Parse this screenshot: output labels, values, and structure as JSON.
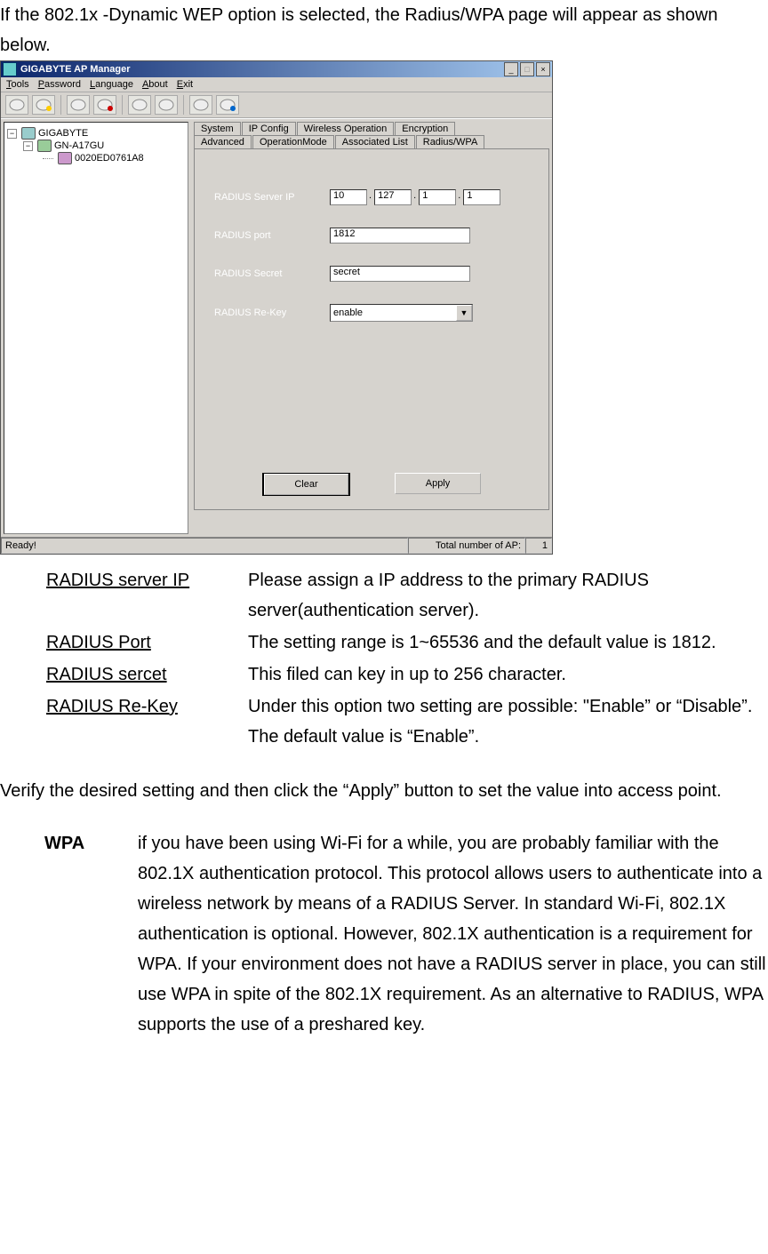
{
  "intro1": "If the 802.1x -Dynamic WEP option is selected, the Radius/WPA page will appear as shown below.",
  "window": {
    "title": "GIGABYTE AP Manager",
    "menutext": {
      "tools": "Tools",
      "password": "Password",
      "language": "Language",
      "about": "About",
      "exit": "Exit"
    },
    "tree": {
      "root": "GIGABYTE",
      "lvl1": "GN-A17GU",
      "lvl2": "0020ED0761A8"
    },
    "tabs": {
      "system": "System",
      "ipconfig": "IP Config",
      "wireless": "Wireless Operation",
      "encryption": "Encryption",
      "advanced": "Advanced",
      "opmode": "OperationMode",
      "assoc": "Associated List",
      "radius": "Radius/WPA"
    },
    "form": {
      "ip_label": "RADIUS Server IP",
      "ip1": "10",
      "ip2": "127",
      "ip3": "1",
      "ip4": "1",
      "port_label": "RADIUS port",
      "port": "1812",
      "secret_label": "RADIUS Secret",
      "secret": "secret",
      "rekey_label": "RADIUS Re-Key",
      "rekey": "enable"
    },
    "buttons": {
      "clear": "Clear",
      "apply": "Apply"
    },
    "status": {
      "ready": "Ready!",
      "aplabel": "Total number of AP:",
      "apnum": "1"
    }
  },
  "desc": {
    "r1_label": "RADIUS server IP",
    "r1_text": "Please assign a IP address to the primary RADIUS server(authentication server).",
    "r2_label": "RADIUS Port",
    "r2_text": "The setting range is 1~65536 and the default value is 1812.",
    "r3_label": "RADIUS sercet",
    "r3_text": "This filed can key in up to 256 character.",
    "r4_label": "RADIUS Re-Key",
    "r4_text": "Under this option two setting are possible: \"Enable” or “Disable”. The default value is “Enable”."
  },
  "verify": "Verify the desired setting and then click the “Apply” button to set the value into access point.",
  "wpa_label": "WPA",
  "wpa_text": "if you have been using Wi-Fi for a while, you are probably familiar with the 802.1X authentication protocol. This protocol allows users to authenticate into a wireless network by means of a RADIUS Server. In standard Wi-Fi, 802.1X authentication is optional. However, 802.1X authentication is a requirement for WPA. If your environment does not have a RADIUS server in place, you can still use WPA in spite of the 802.1X requirement. As an alternative to RADIUS, WPA supports the use of a preshared key."
}
